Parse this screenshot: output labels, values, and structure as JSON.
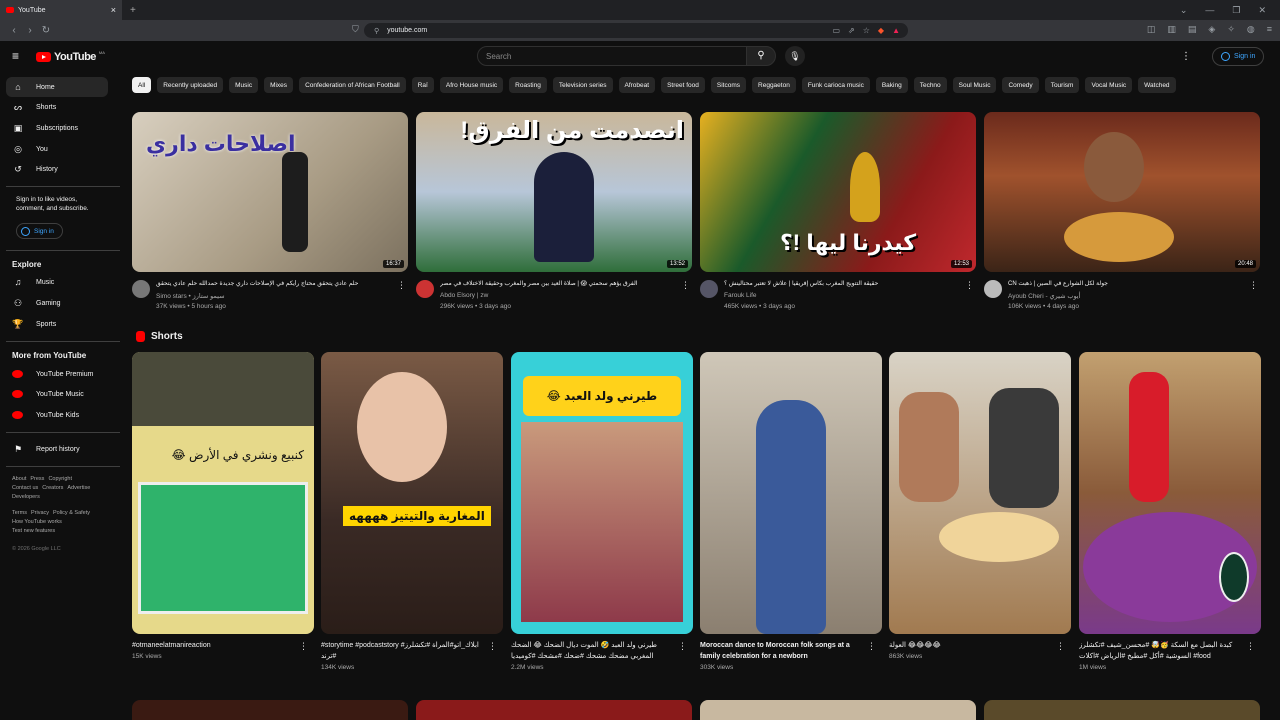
{
  "browser": {
    "tab_title": "YouTube",
    "url": "youtube.com"
  },
  "header": {
    "logo_text": "YouTube",
    "logo_country": "MA",
    "search_placeholder": "Search",
    "signin_label": "Sign in"
  },
  "sidebar": {
    "main_items": [
      {
        "label": "Home",
        "icon": "home-icon"
      },
      {
        "label": "Shorts",
        "icon": "shorts-icon"
      },
      {
        "label": "Subscriptions",
        "icon": "subscriptions-icon"
      },
      {
        "label": "You",
        "icon": "you-icon"
      },
      {
        "label": "History",
        "icon": "history-icon"
      }
    ],
    "signin_prompt": "Sign in to like videos, comment, and subscribe.",
    "signin_label": "Sign in",
    "explore_title": "Explore",
    "explore_items": [
      {
        "label": "Music",
        "icon": "music-icon"
      },
      {
        "label": "Gaming",
        "icon": "gaming-icon"
      },
      {
        "label": "Sports",
        "icon": "sports-icon"
      }
    ],
    "more_title": "More from YouTube",
    "more_items": [
      {
        "label": "YouTube Premium"
      },
      {
        "label": "YouTube Music"
      },
      {
        "label": "YouTube Kids"
      }
    ],
    "report_history": "Report history",
    "footer1": [
      "About",
      "Press",
      "Copyright",
      "Contact us",
      "Creators",
      "Advertise",
      "Developers"
    ],
    "footer2": [
      "Terms",
      "Privacy",
      "Policy & Safety",
      "How YouTube works",
      "Test new features"
    ],
    "copyright": "© 2026 Google LLC"
  },
  "chips": [
    "All",
    "Recently uploaded",
    "Music",
    "Mixes",
    "Confederation of African Football",
    "Raï",
    "Afro House music",
    "Roasting",
    "Television series",
    "Afrobeat",
    "Street food",
    "Sitcoms",
    "Reggaeton",
    "Funk carioca music",
    "Baking",
    "Techno",
    "Soul Music",
    "Comedy",
    "Tourism",
    "Vocal Music",
    "Watched"
  ],
  "videos": [
    {
      "title": "حلم عادي يتحقق محتاج رأيكم في الإصلاحات داري جديدة حمدالله حلم عادي يتحقق",
      "channel": "Simo stars • سيمو ستارز",
      "views": "37K views",
      "age": "5 hours ago",
      "duration": "16:37",
      "overlay": "اصلاحات داري"
    },
    {
      "title": "الفرق يؤهم سحمتي 😱 | صلاة العيد بين مصر والمغرب وحقيقة الاختلاف في مصر",
      "channel": "Abdo Elsory | zw",
      "views": "296K views",
      "age": "3 days ago",
      "duration": "13:52",
      "overlay": "انصدمت من الفرق!"
    },
    {
      "title": "حقيقة التتويج المغرب بكأس إفريقيا | علاش لا تعتبر محتالينش ؟",
      "channel": "Farouk Life",
      "views": "465K views",
      "age": "3 days ago",
      "duration": "12:53",
      "overlay": "كيدرنا ليها !؟"
    },
    {
      "title": "جولة لكل الشوارع في الصين | ذهبت CN",
      "channel": "Ayoub Cheri - أيوب شيري",
      "views": "106K views",
      "age": "4 days ago",
      "duration": "20:48",
      "overlay": ""
    }
  ],
  "shorts_title": "Shorts",
  "shorts": [
    {
      "title": "#otmaneelatmanireaction",
      "views": "15K views",
      "overlay": "كنبيع ونشري في الأرض 😂"
    },
    {
      "title": "#storytime #podcaststory #ابلاك_اتو#المراة #تكشلرز #ترند",
      "views": "134K views",
      "overlay": "المغاربة والتيتيز ههههه"
    },
    {
      "title": "طيرني ولد العبد 🤣 الموت ديال الضحك 😂 الضحك المغربي مضحك مشحك #ضحك #مشحك #كوميديا #تكافيه",
      "views": "2.2M views",
      "overlay": "طيرني ولد العبد 😂"
    },
    {
      "title": "Moroccan dance to Moroccan folk songs at a family celebration for a newborn",
      "views": "303K views",
      "overlay": ""
    },
    {
      "title": "العولة 😂😂😂😂",
      "views": "863K views",
      "overlay": ""
    },
    {
      "title": "كبدة البصل مع السكة 🥳🤯 #محسن_شيف #تكشلرز السوشية #أكل #مطبخ #الرياض #اكلات #food",
      "views": "1M views",
      "overlay": ""
    }
  ]
}
